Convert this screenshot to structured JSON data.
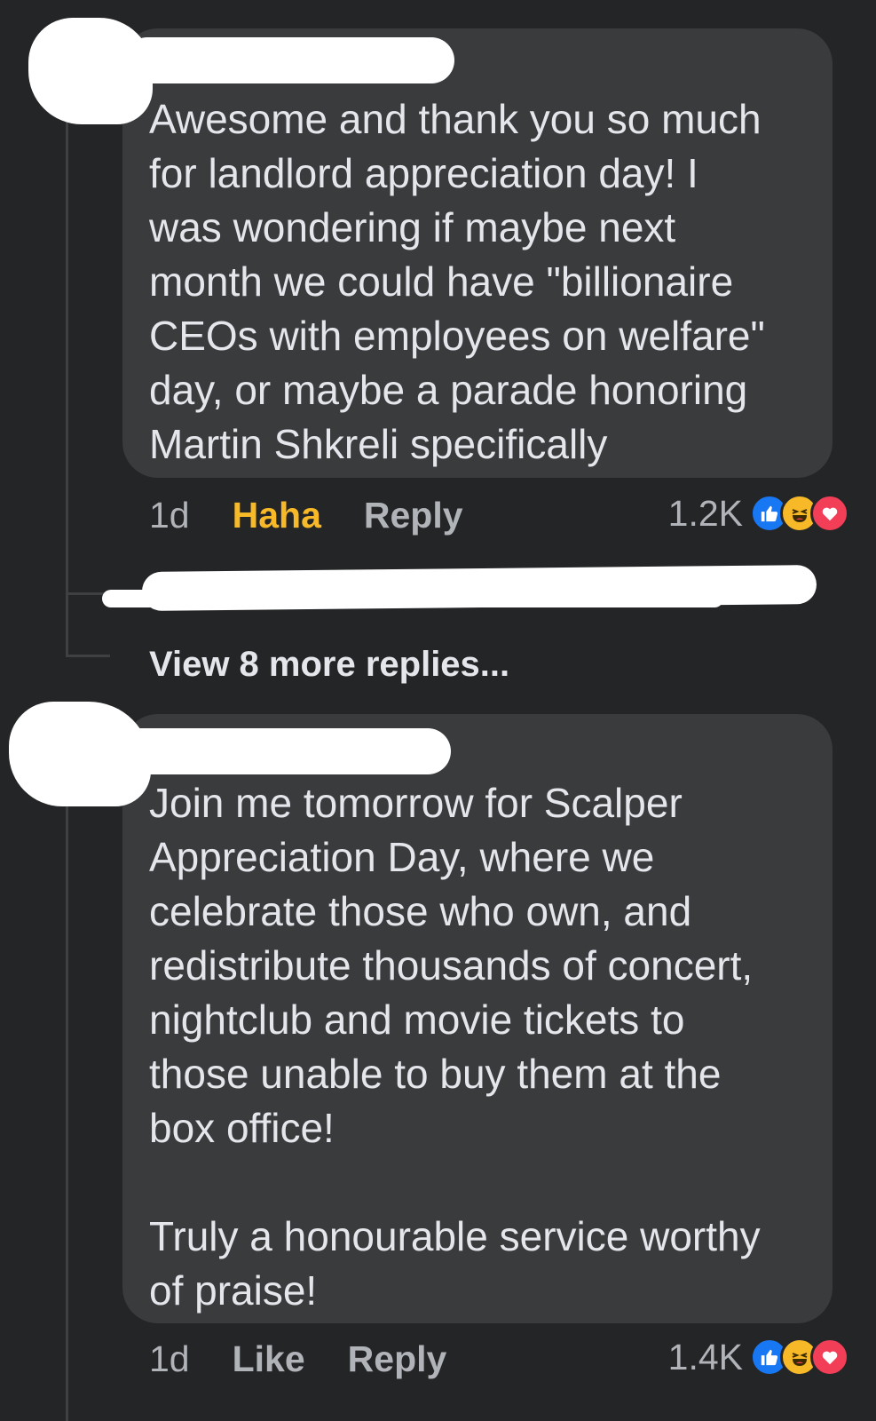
{
  "comment1": {
    "text": "Awesome and thank you so much\nfor landlord appreciation day! I\nwas wondering if maybe next\nmonth we could have \"billionaire\nCEOs with employees on welfare\"\nday, or maybe a parade honoring\nMartin Shkreli specifically",
    "time": "1d",
    "reaction_action": "Haha",
    "reply_label": "Reply",
    "reaction_count": "1.2K"
  },
  "replies": {
    "view_more_label": "View 8 more replies..."
  },
  "comment2": {
    "text": "Join me tomorrow for Scalper\nAppreciation Day, where we\ncelebrate those who own, and\nredistribute thousands of concert,\nnightclub and movie tickets to\nthose unable to buy them at the\nbox office!\n\nTruly a honourable service worthy\nof praise!",
    "time": "1d",
    "like_label": "Like",
    "reply_label": "Reply",
    "reaction_count": "1.4K"
  },
  "reaction_icons": [
    "like-icon",
    "haha-icon",
    "love-icon"
  ],
  "colors": {
    "background": "#242526",
    "bubble": "#3a3b3c",
    "haha_active": "#f7b928",
    "like_blue": "#1877f2",
    "love_red": "#f33e58"
  }
}
